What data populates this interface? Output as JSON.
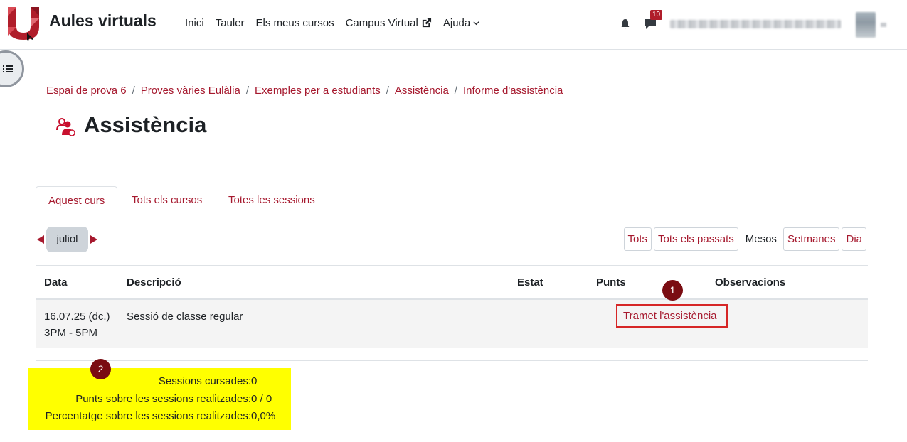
{
  "header": {
    "site_name": "Aules virtuals",
    "nav": [
      "Inici",
      "Tauler",
      "Els meus cursos",
      "Campus Virtual",
      "Ajuda"
    ],
    "message_count": "10"
  },
  "breadcrumb": [
    "Espai de prova 6",
    "Proves vàries Eulàlia",
    "Exemples per a estudiants",
    "Assistència",
    "Informe d'assistència"
  ],
  "page_title": "Assistència",
  "tabs": [
    "Aquest curs",
    "Tots els cursos",
    "Totes les sessions"
  ],
  "period": {
    "month": "juliol"
  },
  "view_buttons": [
    "Tots",
    "Tots els passats",
    "Mesos",
    "Setmanes",
    "Dia"
  ],
  "table": {
    "headers": [
      "Data",
      "Descripció",
      "Estat",
      "Punts",
      "Observacions"
    ],
    "rows": [
      {
        "date": "16.07.25 (dc.)",
        "time": "3PM - 5PM",
        "description": "Sessió de classe regular",
        "action": "Tramet l'assistència"
      }
    ]
  },
  "markers": [
    "1",
    "2"
  ],
  "summary": [
    {
      "label": "Sessions cursades:",
      "value": "0"
    },
    {
      "label": "Punts sobre les sessions realitzades:",
      "value": "0 / 0"
    },
    {
      "label": "Percentatge sobre les sessions realitzades:",
      "value": "0,0%"
    }
  ],
  "colors": {
    "brand": "#a6192e",
    "marker": "#7a0c12",
    "highlight": "#ffff00",
    "annotation_border": "#d62626"
  }
}
